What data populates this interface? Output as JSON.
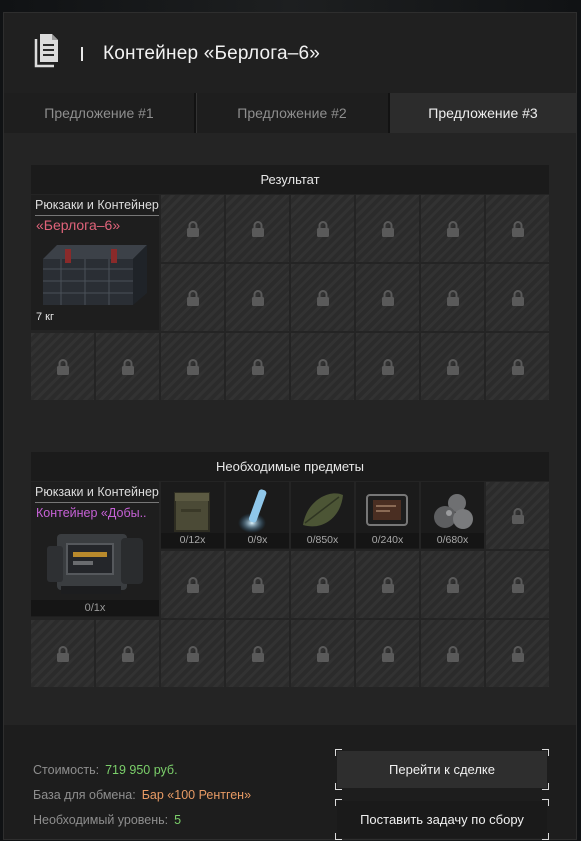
{
  "header": {
    "title": "Контейнер «Берлога–6»",
    "icon": "document-icon"
  },
  "tabs": [
    {
      "label": "Предложение #1",
      "active": false
    },
    {
      "label": "Предложение #2",
      "active": false
    },
    {
      "label": "Предложение #3",
      "active": true
    }
  ],
  "result": {
    "title": "Результат",
    "item": {
      "category": "Рюкзаки и Контейнеры",
      "name": "«Берлога–6»",
      "weight": "7 кг",
      "name_color": "#e0637a"
    }
  },
  "required": {
    "title": "Необходимые предметы",
    "main": {
      "category": "Рюкзаки и Контейнеры",
      "name": "Контейнер «Добы..",
      "count": "0/1x",
      "name_color": "#c661d6"
    },
    "items": [
      {
        "count": "0/12x",
        "icon": "ammo-box-icon"
      },
      {
        "count": "0/9x",
        "icon": "glowing-crystal-icon"
      },
      {
        "count": "0/850x",
        "icon": "leaf-icon"
      },
      {
        "count": "0/240x",
        "icon": "tablet-device-icon"
      },
      {
        "count": "0/680x",
        "icon": "grey-stones-icon"
      }
    ]
  },
  "footer": {
    "cost_label": "Стоимость:",
    "cost_value": "719 950 руб.",
    "base_label": "База для обмена:",
    "base_value": "Бар «100 Рентген»",
    "level_label": "Необходимый уровень:",
    "level_value": "5",
    "deal_button": "Перейти к сделке",
    "task_button": "Поставить задачу по сбору"
  },
  "colors": {
    "green": "#7bcf6a",
    "orange": "#e79a64",
    "accent_red": "#e0637a",
    "accent_purple": "#c661d6"
  }
}
